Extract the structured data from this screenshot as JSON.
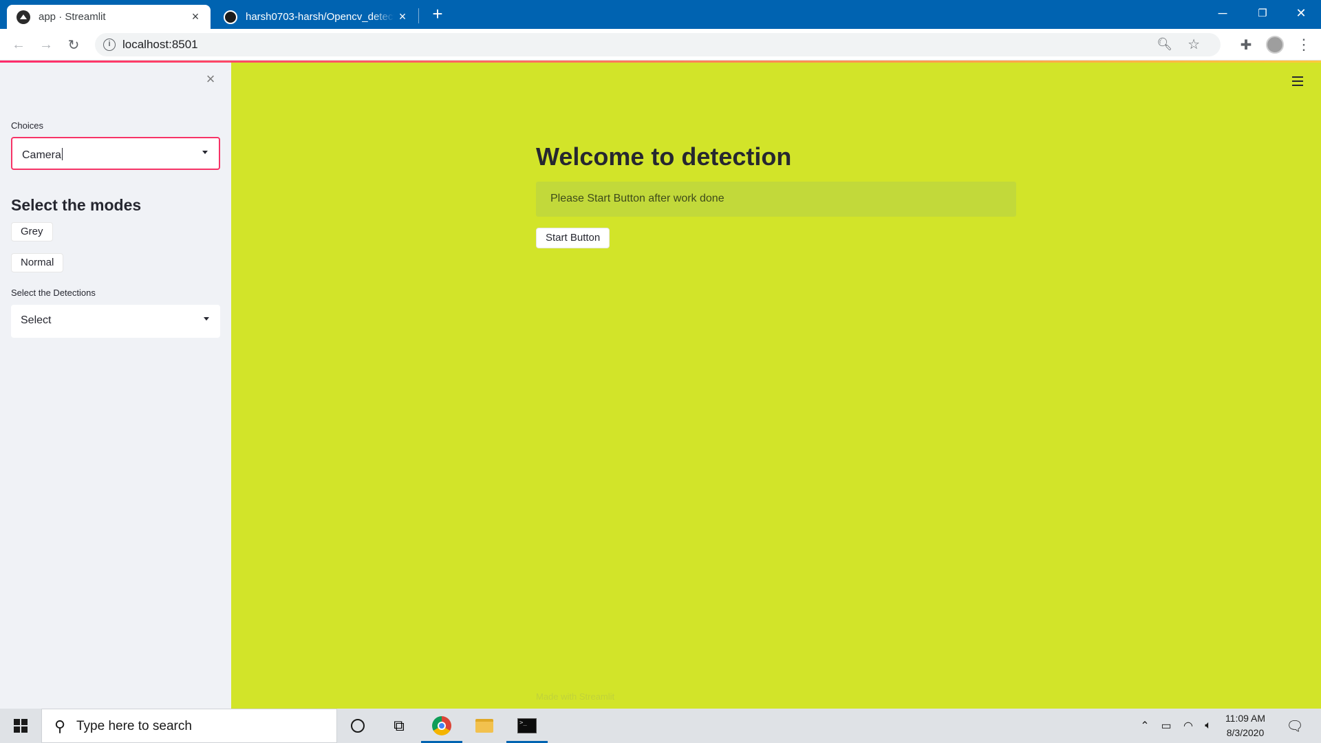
{
  "browser": {
    "tabs": [
      {
        "title": "app · Streamlit",
        "active": true,
        "icon": "streamlit-icon"
      },
      {
        "title": "harsh0703-harsh/Opencv_detecti",
        "active": false,
        "icon": "github-icon"
      }
    ],
    "url": "localhost:8501",
    "window_controls": {
      "minimize": "─",
      "restore": "❐",
      "close": "✕"
    }
  },
  "sidebar": {
    "choices_label": "Choices",
    "choices_value": "Camera",
    "modes_heading": "Select the modes",
    "mode_buttons": [
      "Grey",
      "Normal"
    ],
    "detections_label": "Select the Detections",
    "detections_value": "Select"
  },
  "main": {
    "title": "Welcome to detection",
    "info_message": "Please Start Button after work done",
    "start_button": "Start Button",
    "footer": "Made with Streamlit",
    "background_color": "#d2e429"
  },
  "taskbar": {
    "search_placeholder": "Type here to search",
    "time": "11:09 AM",
    "date": "8/3/2020"
  },
  "colors": {
    "browser_chrome": "#0063b1",
    "sidebar_bg": "#f0f2f6",
    "focus_border": "#f63366",
    "info_box": "#c2d93a"
  }
}
